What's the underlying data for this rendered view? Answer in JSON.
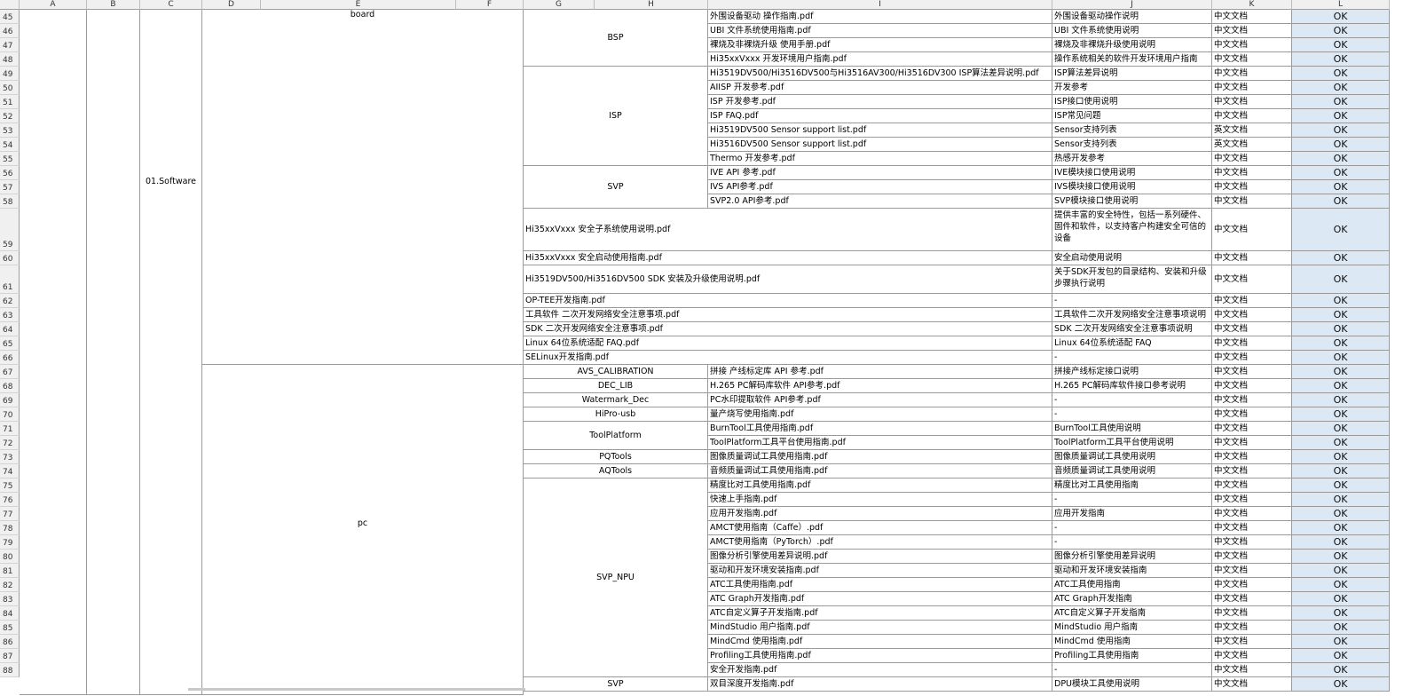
{
  "columns": [
    "A",
    "B",
    "C",
    "D",
    "E",
    "F",
    "G",
    "H",
    "I",
    "J",
    "K",
    "L"
  ],
  "row_numbers": [
    45,
    46,
    47,
    48,
    49,
    50,
    51,
    52,
    53,
    54,
    55,
    56,
    57,
    58,
    59,
    60,
    61,
    62,
    63,
    64,
    65,
    66,
    67,
    68,
    69,
    70,
    71,
    72,
    73,
    74,
    75,
    76,
    77,
    78,
    79,
    80,
    81,
    82,
    83,
    84,
    85,
    86,
    87,
    88
  ],
  "merged": {
    "category": "01.Software",
    "board": "board",
    "pc": "pc"
  },
  "groups": [
    {
      "rows": [
        45,
        48
      ],
      "label": "BSP"
    },
    {
      "rows": [
        49,
        55
      ],
      "label": "ISP"
    },
    {
      "rows": [
        56,
        58
      ],
      "label": "SVP"
    },
    {
      "rows": [
        75,
        88
      ],
      "label": "SVP_NPU"
    }
  ],
  "rows": [
    {
      "r": 45,
      "name": "外围设备驱动 操作指南.pdf",
      "desc": "外围设备驱动操作说明",
      "lang": "中文文档",
      "status": "OK"
    },
    {
      "r": 46,
      "name": "UBI 文件系统使用指南.pdf",
      "desc": "UBI 文件系统使用说明",
      "lang": "中文文档",
      "status": "OK"
    },
    {
      "r": 47,
      "name": "裸烧及非裸烧升级 使用手册.pdf",
      "desc": "裸烧及非裸烧升级使用说明",
      "lang": "中文文档",
      "status": "OK"
    },
    {
      "r": 48,
      "name": "Hi35xxVxxx 开发环境用户指南.pdf",
      "desc": "操作系统相关的软件开发环境用户指南",
      "lang": "中文文档",
      "status": "OK"
    },
    {
      "r": 49,
      "name": "Hi3519DV500/Hi3516DV500与Hi3516AV300/Hi3516DV300 ISP算法差异说明.pdf",
      "desc": "ISP算法差异说明",
      "lang": "中文文档",
      "status": "OK"
    },
    {
      "r": 50,
      "name": "AIISP 开发参考.pdf",
      "desc": "开发参考",
      "lang": "中文文档",
      "status": "OK"
    },
    {
      "r": 51,
      "name": "ISP 开发参考.pdf",
      "desc": "ISP接口使用说明",
      "lang": "中文文档",
      "status": "OK"
    },
    {
      "r": 52,
      "name": "ISP FAQ.pdf",
      "desc": "ISP常见问题",
      "lang": "中文文档",
      "status": "OK"
    },
    {
      "r": 53,
      "name": "Hi3519DV500 Sensor support list.pdf",
      "desc": "Sensor支持列表",
      "lang": "英文文档",
      "status": "OK"
    },
    {
      "r": 54,
      "name": "Hi3516DV500 Sensor support list.pdf",
      "desc": "Sensor支持列表",
      "lang": "英文文档",
      "status": "OK"
    },
    {
      "r": 55,
      "name": "Thermo 开发参考.pdf",
      "desc": "热感开发参考",
      "lang": "中文文档",
      "status": "OK"
    },
    {
      "r": 56,
      "name": "IVE API 参考.pdf",
      "desc": "IVE模块接口使用说明",
      "lang": "中文文档",
      "status": "OK"
    },
    {
      "r": 57,
      "name": "IVS API参考.pdf",
      "desc": "IVS模块接口使用说明",
      "lang": "中文文档",
      "status": "OK"
    },
    {
      "r": 58,
      "name": "SVP2.0 API参考.pdf",
      "desc": "SVP模块接口使用说明",
      "lang": "中文文档",
      "status": "OK"
    },
    {
      "r": 59,
      "gname": "Hi35xxVxxx 安全子系统使用说明.pdf",
      "desc": "提供丰富的安全特性，包括一系列硬件、固件和软件，以支持客户构建安全可信的设备",
      "lang": "中文文档",
      "status": "OK"
    },
    {
      "r": 60,
      "gname": "Hi35xxVxxx  安全启动使用指南.pdf",
      "desc": "安全启动使用说明",
      "lang": "中文文档",
      "status": "OK"
    },
    {
      "r": 61,
      "gname": "Hi3519DV500/Hi3516DV500 SDK 安装及升级使用说明.pdf",
      "desc": "关于SDK开发包的目录结构、安装和升级步骤执行说明",
      "lang": "中文文档",
      "status": "OK"
    },
    {
      "r": 62,
      "gname": "OP-TEE开发指南.pdf",
      "desc": "-",
      "lang": "中文文档",
      "status": "OK"
    },
    {
      "r": 63,
      "gname": "工具软件 二次开发网络安全注意事项.pdf",
      "desc": "工具软件二次开发网络安全注意事项说明",
      "lang": "中文文档",
      "status": "OK"
    },
    {
      "r": 64,
      "gname": "SDK 二次开发网络安全注意事项.pdf",
      "desc": "SDK 二次开发网络安全注意事项说明",
      "lang": "中文文档",
      "status": "OK"
    },
    {
      "r": 65,
      "gname": "Linux 64位系统适配 FAQ.pdf",
      "desc": "Linux 64位系统适配 FAQ",
      "lang": "中文文档",
      "status": "OK"
    },
    {
      "r": 66,
      "gname": "SELinux开发指南.pdf",
      "desc": "-",
      "lang": "中文文档",
      "status": "OK"
    },
    {
      "r": 67,
      "tool": "AVS_CALIBRATION",
      "name": "拼接 产线标定库 API 参考.pdf",
      "desc": "拼接产线标定接口说明",
      "lang": "中文文档",
      "status": "OK"
    },
    {
      "r": 68,
      "tool": "DEC_LIB",
      "name": "H.265 PC解码库软件 API参考.pdf",
      "desc": "H.265 PC解码库软件接口参考说明",
      "lang": "中文文档",
      "status": "OK"
    },
    {
      "r": 69,
      "tool": "Watermark_Dec",
      "name": "PC水印提取软件 API参考.pdf",
      "desc": "-",
      "lang": "中文文档",
      "status": "OK"
    },
    {
      "r": 70,
      "tool": "HiPro-usb",
      "name": "量产烧写使用指南.pdf",
      "desc": "-",
      "lang": "中文文档",
      "status": "OK"
    },
    {
      "r": 71,
      "tool": "ToolPlatform",
      "name": "BurnTool工具使用指南.pdf",
      "desc": "BurnTool工具使用说明",
      "lang": "中文文档",
      "status": "OK"
    },
    {
      "r": 72,
      "name": "ToolPlatform工具平台使用指南.pdf",
      "desc": "ToolPlatform工具平台使用说明",
      "lang": "中文文档",
      "status": "OK"
    },
    {
      "r": 73,
      "tool": "PQTools",
      "name": "图像质量调试工具使用指南.pdf",
      "desc": "图像质量调试工具使用说明",
      "lang": "中文文档",
      "status": "OK"
    },
    {
      "r": 74,
      "tool": "AQTools",
      "name": "音频质量调试工具使用指南.pdf",
      "desc": "音频质量调试工具使用说明",
      "lang": "中文文档",
      "status": "OK"
    },
    {
      "r": 75,
      "name": "精度比对工具使用指南.pdf",
      "desc": "精度比对工具使用指南",
      "lang": "中文文档",
      "status": "OK"
    },
    {
      "r": 76,
      "name": "快速上手指南.pdf",
      "desc": "-",
      "lang": "中文文档",
      "status": "OK"
    },
    {
      "r": 77,
      "name": "应用开发指南.pdf",
      "desc": "应用开发指南",
      "lang": "中文文档",
      "status": "OK"
    },
    {
      "r": 78,
      "name": "AMCT使用指南（Caffe）.pdf",
      "desc": "-",
      "lang": "中文文档",
      "status": "OK"
    },
    {
      "r": 79,
      "name": "AMCT使用指南（PyTorch）.pdf",
      "desc": "-",
      "lang": "中文文档",
      "status": "OK"
    },
    {
      "r": 80,
      "name": "图像分析引擎使用差异说明.pdf",
      "desc": "图像分析引擎使用差异说明",
      "lang": "中文文档",
      "status": "OK"
    },
    {
      "r": 81,
      "name": "驱动和开发环境安装指南.pdf",
      "desc": "驱动和开发环境安装指南",
      "lang": "中文文档",
      "status": "OK"
    },
    {
      "r": 82,
      "name": "ATC工具使用指南.pdf",
      "desc": "ATC工具使用指南",
      "lang": "中文文档",
      "status": "OK"
    },
    {
      "r": 83,
      "name": "ATC Graph开发指南.pdf",
      "desc": "ATC Graph开发指南",
      "lang": "中文文档",
      "status": "OK"
    },
    {
      "r": 84,
      "name": "ATC自定义算子开发指南.pdf",
      "desc": "ATC自定义算子开发指南",
      "lang": "中文文档",
      "status": "OK"
    },
    {
      "r": 85,
      "name": "MindStudio 用户指南.pdf",
      "desc": "MindStudio 用户指南",
      "lang": "中文文档",
      "status": "OK"
    },
    {
      "r": 86,
      "name": "MindCmd 使用指南.pdf",
      "desc": "MindCmd 使用指南",
      "lang": "中文文档",
      "status": "OK"
    },
    {
      "r": 87,
      "name": "Profiling工具使用指南.pdf",
      "desc": "Profiling工具使用指南",
      "lang": "中文文档",
      "status": "OK"
    },
    {
      "r": 88,
      "name": "安全开发指南.pdf",
      "desc": "-",
      "lang": "中文文档",
      "status": "OK"
    }
  ],
  "partial_row": {
    "tool": "SVP",
    "name": "双目深度开发指南.pdf",
    "desc": "DPU模块工具使用说明",
    "lang": "中文文档",
    "status": "OK"
  }
}
